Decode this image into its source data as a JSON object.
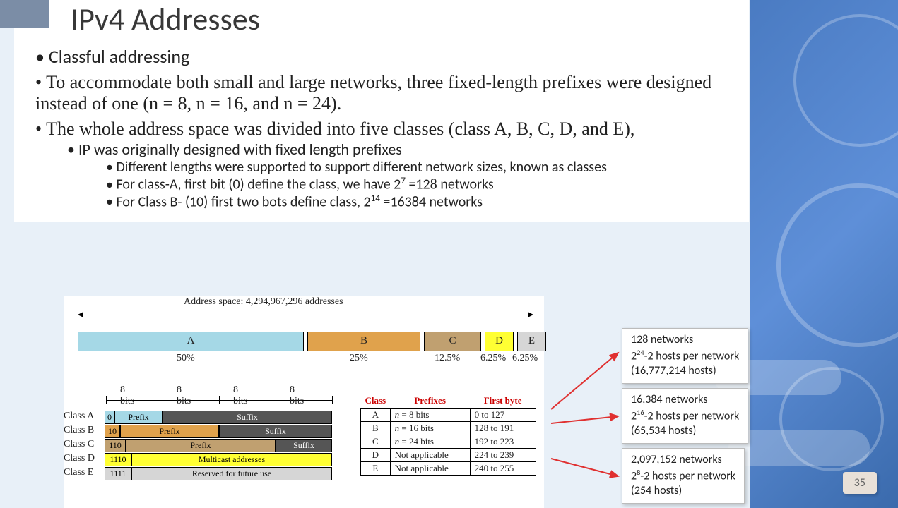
{
  "title": "IPv4 Addresses",
  "bullets": {
    "b1": "Classful addressing",
    "b2": "To accommodate both small and large networks, three fixed-length prefixes were designed instead of one (n = 8, n = 16, and n = 24).",
    "b3": "The whole address space was divided into five classes (class A, B, C, D, and E),",
    "b3a": "IP was originally designed with fixed length prefixes",
    "b3a1": "Different lengths were supported to support different network sizes, known as classes",
    "b3a2_pre": "For class-A, first bit (0) define the class, we have 2",
    "b3a2_exp": "7",
    "b3a2_post": " =128 networks",
    "b3a3_pre": "For Class B- (10) first two bots define class, 2",
    "b3a3_exp": "14",
    "b3a3_post": " =16384 networks"
  },
  "diagram": {
    "address_space_label": "Address space: 4,294,967,296 addresses",
    "segments": {
      "A": {
        "label": "A",
        "pct": "50%"
      },
      "B": {
        "label": "B",
        "pct": "25%"
      },
      "C": {
        "label": "C",
        "pct": "12.5%"
      },
      "D": {
        "label": "D",
        "pct": "6.25%"
      },
      "E": {
        "label": "E",
        "pct": "6.25%"
      }
    },
    "bit_label": "8 bits",
    "rows": {
      "A": {
        "name": "Class A",
        "lead": "0",
        "p": "Prefix",
        "s": "Suffix"
      },
      "B": {
        "name": "Class B",
        "lead": "10",
        "p": "Prefix",
        "s": "Suffix"
      },
      "C": {
        "name": "Class C",
        "lead": "110",
        "p": "Prefix",
        "s": "Suffix"
      },
      "D": {
        "name": "Class D",
        "lead": "1110",
        "p": "Multicast addresses"
      },
      "E": {
        "name": "Class E",
        "lead": "1111",
        "p": "Reserved for future use"
      }
    },
    "table": {
      "h1": "Class",
      "h2": "Prefixes",
      "h3": "First byte",
      "r": [
        {
          "c": "A",
          "p_i": "n",
          "p": " = 8 bits",
          "f": "0 to 127"
        },
        {
          "c": "B",
          "p_i": "n",
          "p": " = 16 bits",
          "f": "128 to 191"
        },
        {
          "c": "C",
          "p_i": "n",
          "p": " = 24 bits",
          "f": "192 to 223"
        },
        {
          "c": "D",
          "p_i": "",
          "p": "Not applicable",
          "f": "224 to 239"
        },
        {
          "c": "E",
          "p_i": "",
          "p": "Not applicable",
          "f": "240 to 255"
        }
      ]
    }
  },
  "sideboxes": {
    "s1_l1": "128 networks",
    "s1_l2a": "2",
    "s1_l2exp": "24",
    "s1_l2b": "-2 hosts per network",
    "s1_l3": "(16,777,214 hosts)",
    "s2_l1": "16,384 networks",
    "s2_l2a": "2",
    "s2_l2exp": "16",
    "s2_l2b": "-2 hosts per network",
    "s2_l3": "(65,534 hosts)",
    "s3_l1": "2,097,152 networks",
    "s3_l2a": "2",
    "s3_l2exp": "8",
    "s3_l2b": "-2 hosts per network",
    "s3_l3": "(254 hosts)"
  },
  "slide_number": "35"
}
